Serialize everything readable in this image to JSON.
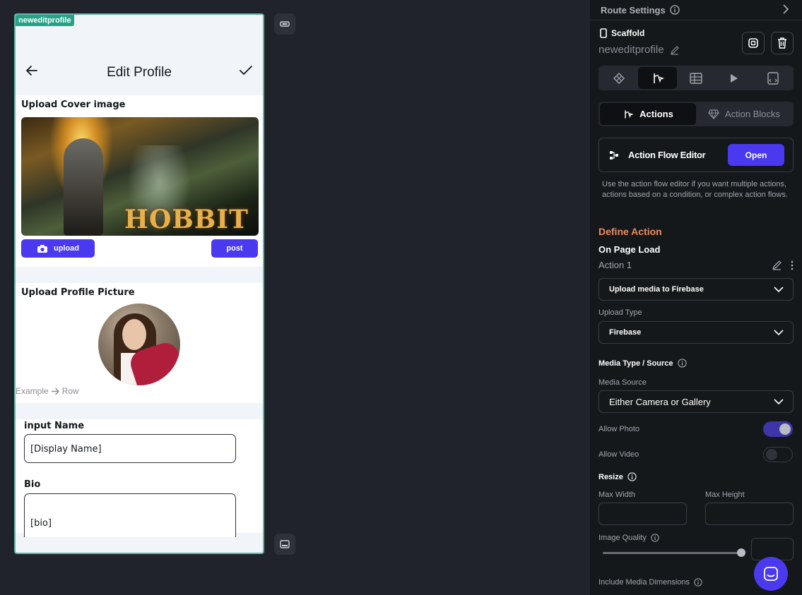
{
  "canvas": {
    "page_tag": "neweditprofile",
    "appbar": {
      "title": "Edit Profile"
    },
    "cover_section": {
      "label": "Upload Cover image",
      "image_title": "HOBBIT",
      "upload_label": "upload",
      "post_label": "post"
    },
    "profile_section": {
      "label": "Upload Profile Picture",
      "breadcrumb_from": "Example",
      "breadcrumb_to": "Row"
    },
    "form": {
      "name_label": "input Name",
      "name_value": "[Display Name]",
      "bio_label": "Bio",
      "bio_value": "[bio]"
    }
  },
  "panel": {
    "route_settings": "Route Settings",
    "scaffold": "Scaffold",
    "page_name": "neweditprofile",
    "seg_actions": "Actions",
    "seg_action_blocks": "Action Blocks",
    "action_flow_editor": "Action Flow Editor",
    "open_label": "Open",
    "help_text": "Use the action flow editor if you want multiple actions, actions based on a condition, or complex action flows.",
    "define_action": "Define Action",
    "on_page_load": "On Page Load",
    "action_1": "Action 1",
    "action_select": "Upload media to Firebase",
    "upload_type_label": "Upload Type",
    "upload_type_value": "Firebase",
    "media_type_source": "Media Type / Source",
    "media_source_label": "Media Source",
    "media_source_value": "Either Camera or Gallery",
    "allow_photo": "Allow Photo",
    "allow_photo_on": true,
    "allow_video": "Allow Video",
    "allow_video_on": false,
    "resize": "Resize",
    "max_width": "Max Width",
    "max_height": "Max Height",
    "image_quality": "Image Quality",
    "image_quality_level": 1.0,
    "include_media_dimensions": "Include Media Dimensions"
  },
  "colors": {
    "accent": "#4b39ef",
    "section_heading": "#ee8b60",
    "page_tag": "#27a187",
    "canvas_border": "#5fb7a8"
  },
  "icons": [
    "back-arrow-icon",
    "check-icon",
    "camera-icon",
    "info-icon",
    "chevron-right-icon",
    "phone-icon",
    "edit-icon",
    "copy-icon",
    "trash-icon",
    "widget-icon",
    "actions-icon",
    "backend-query-icon",
    "play-icon",
    "page-code-icon",
    "gem-icon",
    "flow-icon",
    "more-vert-icon",
    "caret-down-icon",
    "chat-icon"
  ]
}
